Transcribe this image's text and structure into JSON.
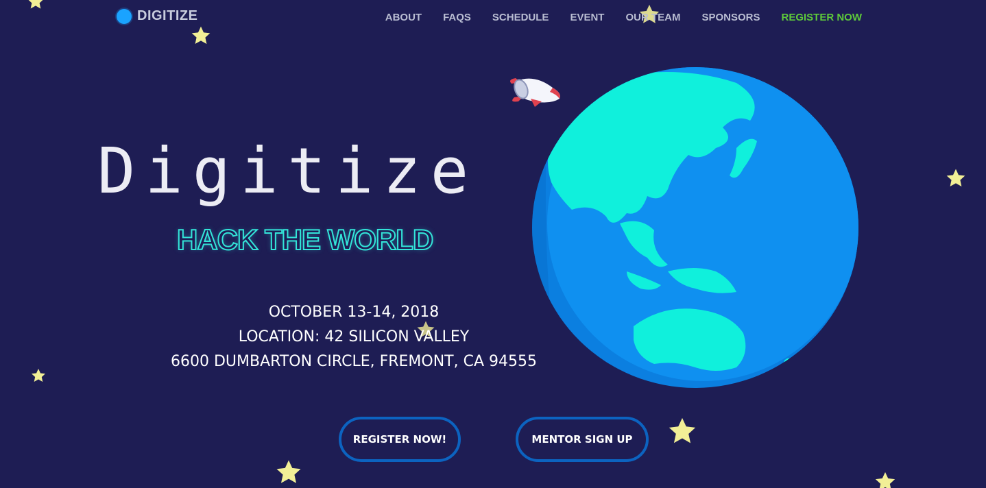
{
  "nav": {
    "brand": "DIGITIZE",
    "links": [
      {
        "label": "ABOUT"
      },
      {
        "label": "FAQS"
      },
      {
        "label": "SCHEDULE"
      },
      {
        "label": "EVENT"
      },
      {
        "label": "OUR TEAM"
      },
      {
        "label": "SPONSORS"
      },
      {
        "label": "REGISTER NOW"
      }
    ]
  },
  "hero": {
    "title": "Digitize",
    "subtitle": "HACK THE WORLD",
    "date": "OCTOBER 13-14, 2018",
    "location": "LOCATION: 42 SILICON VALLEY",
    "address": "6600 DUMBARTON CIRCLE, FREMONT, CA 94555"
  },
  "buttons": {
    "register": "REGISTER NOW!",
    "mentor": "MENTOR SIGN UP"
  },
  "colors": {
    "background": "#1e1d54",
    "accent_green": "#5ecb3a",
    "accent_cyan": "#33e5d9",
    "button_border": "#0c63c0",
    "planet_ocean": "#0f90f0",
    "planet_land": "#10f0dc"
  },
  "icons": [
    "logo-dot-icon",
    "rocket-icon",
    "planet-earth-icon",
    "star-icon"
  ]
}
